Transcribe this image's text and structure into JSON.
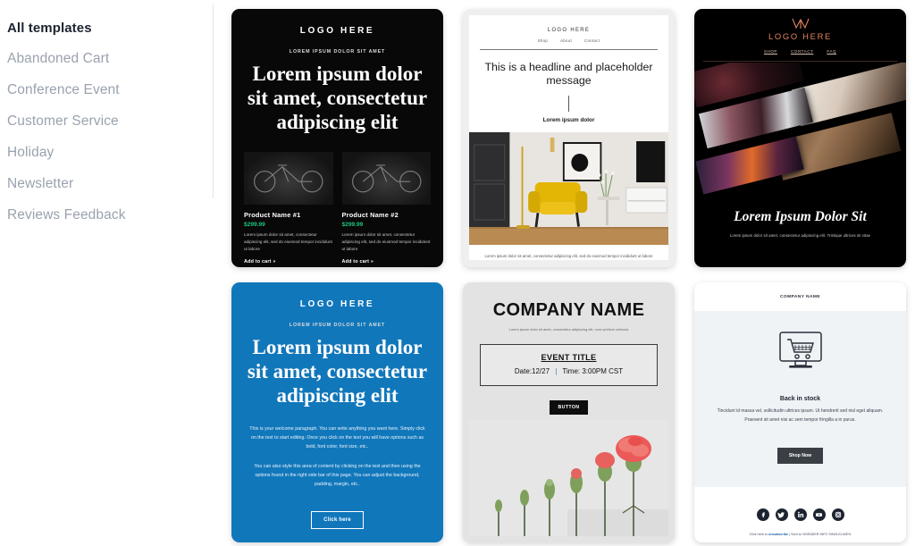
{
  "sidebar": {
    "items": [
      {
        "label": "All templates",
        "active": true
      },
      {
        "label": "Abandoned Cart",
        "active": false
      },
      {
        "label": "Conference Event",
        "active": false
      },
      {
        "label": "Customer Service",
        "active": false
      },
      {
        "label": "Holiday",
        "active": false
      },
      {
        "label": "Newsletter",
        "active": false
      },
      {
        "label": "Reviews Feedback",
        "active": false
      }
    ]
  },
  "colors": {
    "promo_dark_bg": "#080808",
    "promo_blue_bg": "#1177bb",
    "price_green": "#1bc47d",
    "gallery_accent": "#e2855f",
    "event_bg": "#e3e3e3",
    "stock_body_bg": "#eff3f6",
    "active_nav": "#1d2430",
    "inactive_nav": "#9aa2ae"
  },
  "templates": {
    "card1": {
      "logo": "LOGO HERE",
      "kicker": "LOREM IPSUM DOLOR SIT AMET",
      "headline": "Lorem ipsum dolor sit amet, consectetur adipiscing elit",
      "products": [
        {
          "name": "Product Name #1",
          "price": "$299.99",
          "desc": "Lorem ipsum dolor sit amet, consectetur adipiscing elit, sed do eiusmod tempor incididunt ut labore",
          "cta": "Add to cart »",
          "image": "bicycle-photo"
        },
        {
          "name": "Product Name #2",
          "price": "$299.99",
          "desc": "Lorem ipsum dolor sit amet, consectetur adipiscing elit, sed do eiusmod tempor incididunt ut labore",
          "cta": "Add to cart »",
          "image": "bicycle-photo"
        }
      ]
    },
    "card2": {
      "logo": "LOGO HERE",
      "nav": [
        "Shop",
        "About",
        "Contact"
      ],
      "headline": "This is a headline and placeholder message",
      "subheadline": "Lorem ipsum dolor",
      "image": "living-room-yellow-armchair-photo",
      "footer": "Lorem ipsum dolor sit amet, consectetur adipiscing elit, sed do eiusmod tempor incididunt ut labore et dolore magna aliqua. Ut enim"
    },
    "card3": {
      "monogram": "w-monogram-icon",
      "logo": "LOGO HERE",
      "nav": [
        "SHOP",
        "CONTACT",
        "FAQ"
      ],
      "gallery": "angled-artwork-tiles",
      "headline": "Lorem Ipsum Dolor Sit",
      "subtext": "Lorem ipsum dolor sit amet, consectetur adipiscing elit. Tristique ultrices sit vitae"
    },
    "card4": {
      "logo": "LOGO HERE",
      "kicker": "LOREM IPSUM DOLOR SIT AMET",
      "headline": "Lorem ipsum dolor sit amet, consectetur adipiscing elit",
      "paragraph1": "This is your welcome paragraph. You can write anything you want here. Simply click on the text to start editing. Once you click on the text you will have options such as bold, font color, font size, etc..",
      "paragraph2": "You can also style this area of content by clicking on the text and then using the options found in the right side bar of this page. You can adjust the background, padding, margin, etc..",
      "button": "Click here"
    },
    "card5": {
      "company": "COMPANY NAME",
      "tagline": "Lorem ipsum dolor sit amet, consectetur adipiscing elit, nunc pretium vehicula",
      "event_title": "EVENT TITLE",
      "event_date": "Date:12/27",
      "event_separator": "|",
      "event_time": "Time: 3:00PM CST",
      "button": "BUTTON",
      "image": "carnation-flower-growth-stages-photo"
    },
    "card6": {
      "company": "COMPANY NAME",
      "icon": "monitor-shopping-cart-icon",
      "title": "Back in stock",
      "text": "Tincidunt id massa vel, sollicitudin ultrices ipsum. Ut hendrerit sed nisl eget aliquam. Praesent sit amet nisi ac sem tempor fringilla a in purus.",
      "button": "Shop Now",
      "social": [
        "facebook-icon",
        "twitter-icon",
        "linkedin-icon",
        "youtube-icon",
        "instagram-icon"
      ],
      "footer_prefix": "Click here to ",
      "footer_link": "unsubscribe",
      "footer_suffix": " | Sent to %SENDER INFO SINGLELINE%"
    }
  }
}
